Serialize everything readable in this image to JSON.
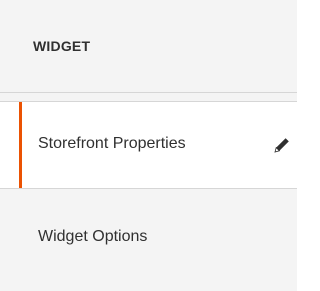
{
  "section": {
    "title": "WIDGET"
  },
  "tabs": [
    {
      "label": "Storefront Properties",
      "active": true,
      "icon": "pencil-icon"
    },
    {
      "label": "Widget Options",
      "active": false
    }
  ],
  "colors": {
    "accent": "#eb5202",
    "text": "#303030",
    "panel_background": "#f4f4f4",
    "active_background": "#ffffff",
    "divider": "#d6d6d6"
  }
}
